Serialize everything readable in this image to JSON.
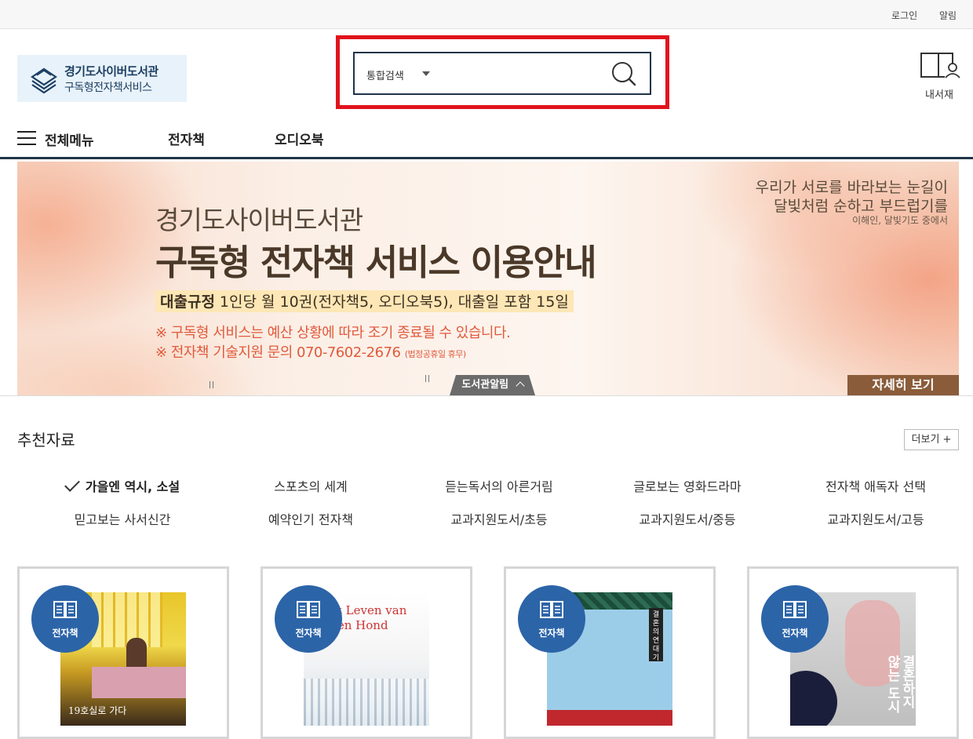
{
  "topbar": {
    "login": "로그인",
    "alarm": "알림"
  },
  "logo": {
    "line1": "경기도사이버도서관",
    "line2": "구독형전자책서비스",
    "icon": "books-stack-icon"
  },
  "search": {
    "scope": "통합검색",
    "query": "",
    "placeholder": "",
    "highlight_color": "#e0141c"
  },
  "mylib": {
    "label": "내서재",
    "icon": "book-person-icon"
  },
  "nav": {
    "menu_all": "전체메뉴",
    "items": [
      "전자책",
      "오디오북"
    ]
  },
  "banner": {
    "subtitle": "경기도사이버도서관",
    "title": "구독형 전자책 서비스 이용안내",
    "rule_label": "대출규정",
    "rule_text": "1인당 월 10권(전자책5, 오디오북5), 대출일 포함 15일",
    "note1": "※ 구독형 서비스는 예산 상황에 따라 조기 종료될 수 있습니다.",
    "note2": "※ 전자책 기술지원 문의 070-7602-2676",
    "note2_small": "(법정공휴일 휴무)",
    "quote_line1": "우리가 서로를 바라보는 눈길이",
    "quote_line2": "달빛처럼 순하고 부드럽기를",
    "quote_source": "이해인, 달빛기도 중에서",
    "more_button": "자세히 보기",
    "notice_tab": "도서관알림"
  },
  "recommend": {
    "title": "추천자료",
    "more": "더보기 +",
    "categories_row1": [
      "가을엔 역시, 소설",
      "스포츠의 세계",
      "듣는독서의 아른거림",
      "글로보는 영화드라마",
      "전자책 애독자 선택"
    ],
    "categories_row2": [
      "믿고보는 사서신간",
      "예약인기 전자책",
      "교과지원도서/초등",
      "교과지원도서/중등",
      "교과지원도서/고등"
    ],
    "active_index": 0
  },
  "books": [
    {
      "badge": "전자책",
      "cover_text": "19호실로 가다"
    },
    {
      "badge": "전자책",
      "cover_text": "et Leven van een Hond"
    },
    {
      "badge": "전자책",
      "cover_text": "결혼의 연대기"
    },
    {
      "badge": "전자책",
      "cover_text": "결혼하지 않는 도시"
    }
  ],
  "colors": {
    "nav_line": "#1f3447",
    "badge": "#2c64a8",
    "banner_button": "#8a5c3a",
    "banner_note": "#e15a3c"
  }
}
